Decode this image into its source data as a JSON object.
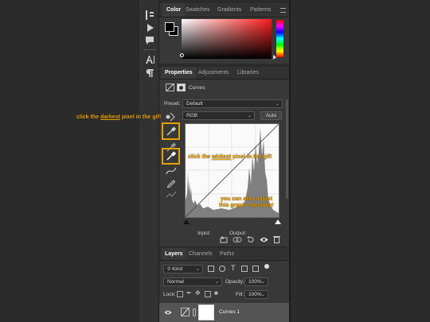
{
  "color_panel": {
    "tabs": [
      "Color",
      "Swatches",
      "Gradients",
      "Patterns"
    ],
    "active_tab": "Color"
  },
  "properties_panel": {
    "tabs": [
      "Properties",
      "Adjustments",
      "Libraries"
    ],
    "active_tab": "Properties",
    "adjustment_name": "Curves",
    "preset_label": "Preset:",
    "preset_value": "Default",
    "channel_value": "RGB",
    "auto_label": "Auto",
    "input_label": "Input:",
    "output_label": "Output:"
  },
  "annotations": {
    "darkest_pre": "click the ",
    "darkest_u": "darkest",
    "darkest_post": " pixel in the gif!",
    "whitest_pre": "click the ",
    "whitest_u": "whitest",
    "whitest_post": " pixel in the gif!",
    "adjust_line1": "you can also adjust",
    "adjust_line2": "this graph manually!"
  },
  "layers_panel": {
    "tabs": [
      "Layers",
      "Channels",
      "Paths"
    ],
    "active_tab": "Layers",
    "filter_value": "Kind",
    "blend_mode": "Normal",
    "opacity_label": "Opacity:",
    "opacity_value": "100%",
    "lock_label": "Lock:",
    "fill_label": "Fill:",
    "fill_value": "100%",
    "layer_name": "Curves 1"
  },
  "colors": {
    "accent_orange": "#f0a500",
    "panel_bg": "#383838",
    "app_bg": "#2b2b2b"
  }
}
